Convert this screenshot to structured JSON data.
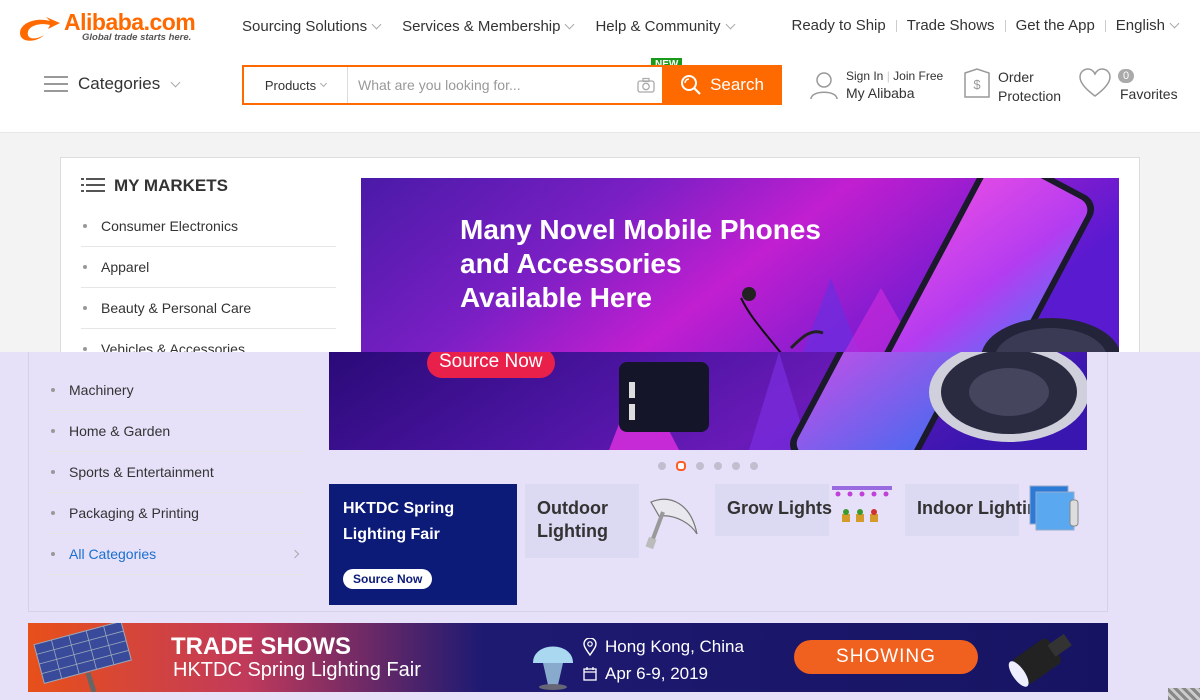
{
  "header": {
    "logo_brand": "Alibaba.com",
    "logo_tagline": "Global trade starts here.",
    "nav": [
      "Sourcing Solutions",
      "Services & Membership",
      "Help & Community"
    ],
    "toplinks": [
      "Ready to Ship",
      "Trade Shows",
      "Get the App",
      "English"
    ],
    "categories_label": "Categories",
    "search": {
      "dropdown": "Products",
      "placeholder": "What are you looking for...",
      "button": "Search",
      "badge": "NEW"
    },
    "account": {
      "sign_in": "Sign In",
      "join": "Join Free",
      "my": "My Alibaba"
    },
    "order": {
      "line1": "Order",
      "line2": "Protection"
    },
    "favorites": {
      "count": "0",
      "label": "Favorites"
    }
  },
  "markets": {
    "title": "MY MARKETS",
    "items_top": [
      "Consumer Electronics",
      "Apparel",
      "Beauty & Personal Care",
      "Vehicles & Accessories"
    ],
    "items_bottom": [
      "Machinery",
      "Home & Garden",
      "Sports & Entertainment",
      "Packaging & Printing",
      "All Categories"
    ]
  },
  "banner": {
    "headline_1": "Many Novel Mobile Phones",
    "headline_2": "and Accessories",
    "headline_3": "Available Here",
    "cta": "Source Now",
    "slides": 6,
    "active_slide": 2
  },
  "tiles": {
    "hktdc_title_1": "HKTDC Spring",
    "hktdc_title_2": "Lighting Fair",
    "hktdc_btn": "Source Now",
    "outdoor_1": "Outdoor",
    "outdoor_2": "Lighting",
    "grow": "Grow Lights",
    "indoor": "Indoor Lighting"
  },
  "trade": {
    "heading": "TRADE SHOWS",
    "fair": "HKTDC Spring Lighting Fair",
    "location": "Hong Kong, China",
    "dates": "Apr 6-9, 2019",
    "status": "SHOWING"
  },
  "colors": {
    "accent": "#ff6a00",
    "link": "#1a6fcf",
    "lavender": "#e6e1f9",
    "navy": "#0c1a78"
  }
}
